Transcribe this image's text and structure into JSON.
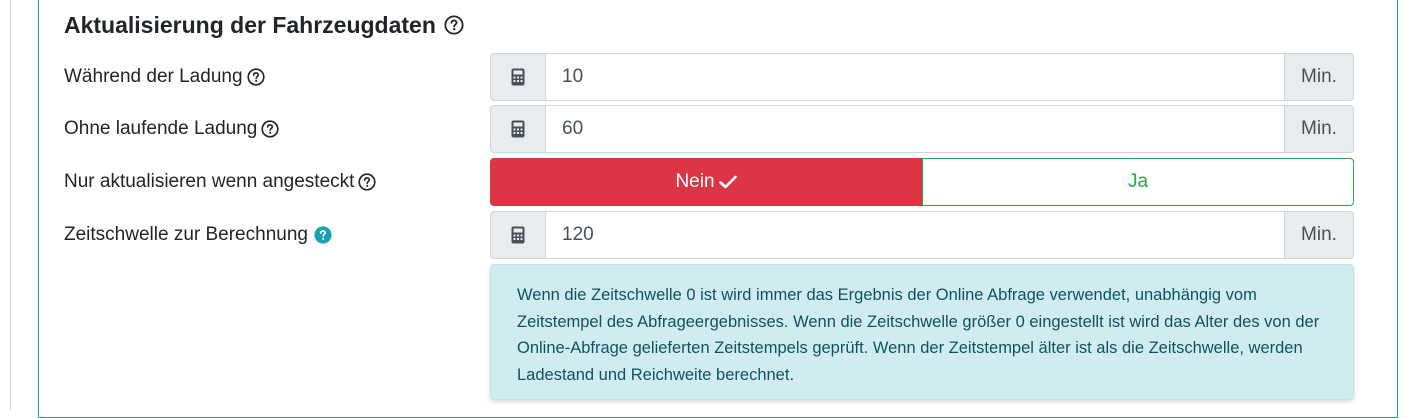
{
  "section": {
    "title": "Aktualisierung der Fahrzeugdaten"
  },
  "fields": [
    {
      "label": "Während der Ladung",
      "value": "10",
      "unit": "Min."
    },
    {
      "label": "Ohne laufende Ladung",
      "value": "60",
      "unit": "Min."
    },
    {
      "label": "Nur aktualisieren wenn angesteckt",
      "options": [
        "Nein",
        "Ja"
      ],
      "selected": "Nein"
    },
    {
      "label": "Zeitschwelle zur Berechnung",
      "value": "120",
      "unit": "Min."
    }
  ],
  "info": {
    "text": "Wenn die Zeitschwelle 0 ist wird immer das Ergebnis der Online Abfrage verwendet, unabhängig vom Zeitstempel des Abfrageergebnisses. Wenn die Zeitschwelle größer 0 eingestellt ist wird das Alter des von der Online-Abfrage gelieferten Zeitstempels geprüft. Wenn der Zeitstempel älter ist als die Zeitschwelle, werden Ladestand und Reichweite berechnet."
  },
  "icons": {
    "help": "question-circle-icon",
    "help_active": "question-circle-filled-icon",
    "calculator": "calculator-icon",
    "check": "check-icon"
  },
  "colors": {
    "danger": "#dc3545",
    "success": "#28a745",
    "info": "#17a2b8",
    "info_bg": "#d1ecf1",
    "info_text": "#0c5460"
  }
}
